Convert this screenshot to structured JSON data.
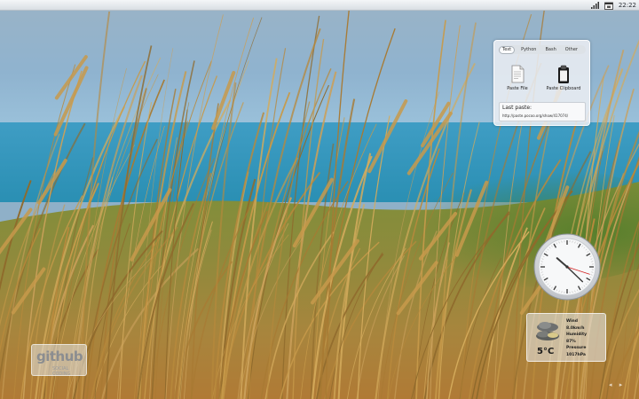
{
  "top_panel": {
    "time": "22:22",
    "signal_icon": "signal-bars-icon",
    "calendar_icon": "calendar-icon"
  },
  "paste_widget": {
    "tabs": [
      "Text",
      "Python",
      "Bash",
      "Other"
    ],
    "active_tab": "Text",
    "actions": [
      {
        "label": "Paste File",
        "icon": "document-icon"
      },
      {
        "label": "Paste Clipboard",
        "icon": "clipboard-icon"
      }
    ],
    "last_paste_label": "Last paste:",
    "last_paste_url": "http://paste.pocoo.org/show/417074/"
  },
  "clock_widget": {
    "hour": 22,
    "minute": 22,
    "second": 18
  },
  "weather_widget": {
    "temperature": "5°C",
    "icon": "cloudy-weather-icon",
    "wind_label": "Wind",
    "wind_value": "8.0km/h",
    "humidity_label": "Humidity",
    "humidity_value": "87%",
    "pressure_label": "Pressure",
    "pressure_value": "1017hPa"
  },
  "github_badge": {
    "word": "github",
    "tagline": "SOCIAL CODING"
  },
  "corner": {
    "arrows": "◂ ▸"
  },
  "colors": {
    "sky": "#8fb3cf",
    "sea": "#2f95b9",
    "grass": "#b58a3e",
    "clock_second_hand": "#d22020"
  }
}
